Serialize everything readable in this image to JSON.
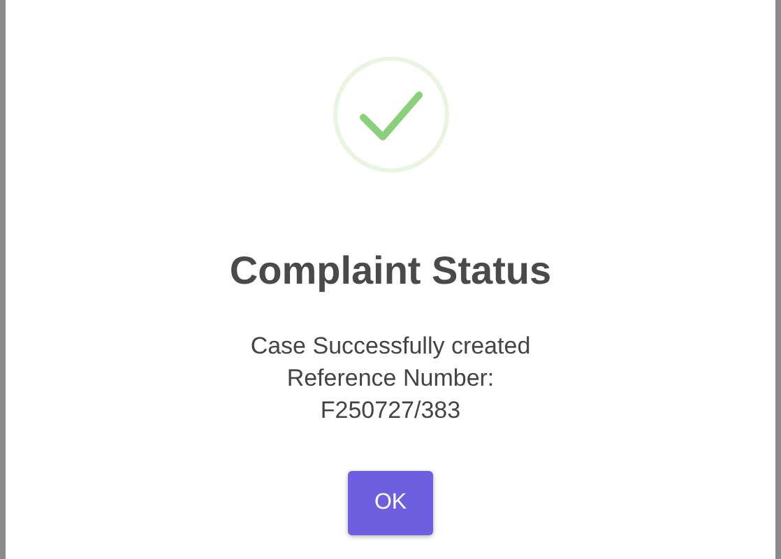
{
  "dialog": {
    "title": "Complaint Status",
    "message_lines": [
      "Case Successfully created",
      "Reference Number:",
      "F250727/383"
    ],
    "buttons": [
      {
        "label": "OK"
      }
    ]
  }
}
